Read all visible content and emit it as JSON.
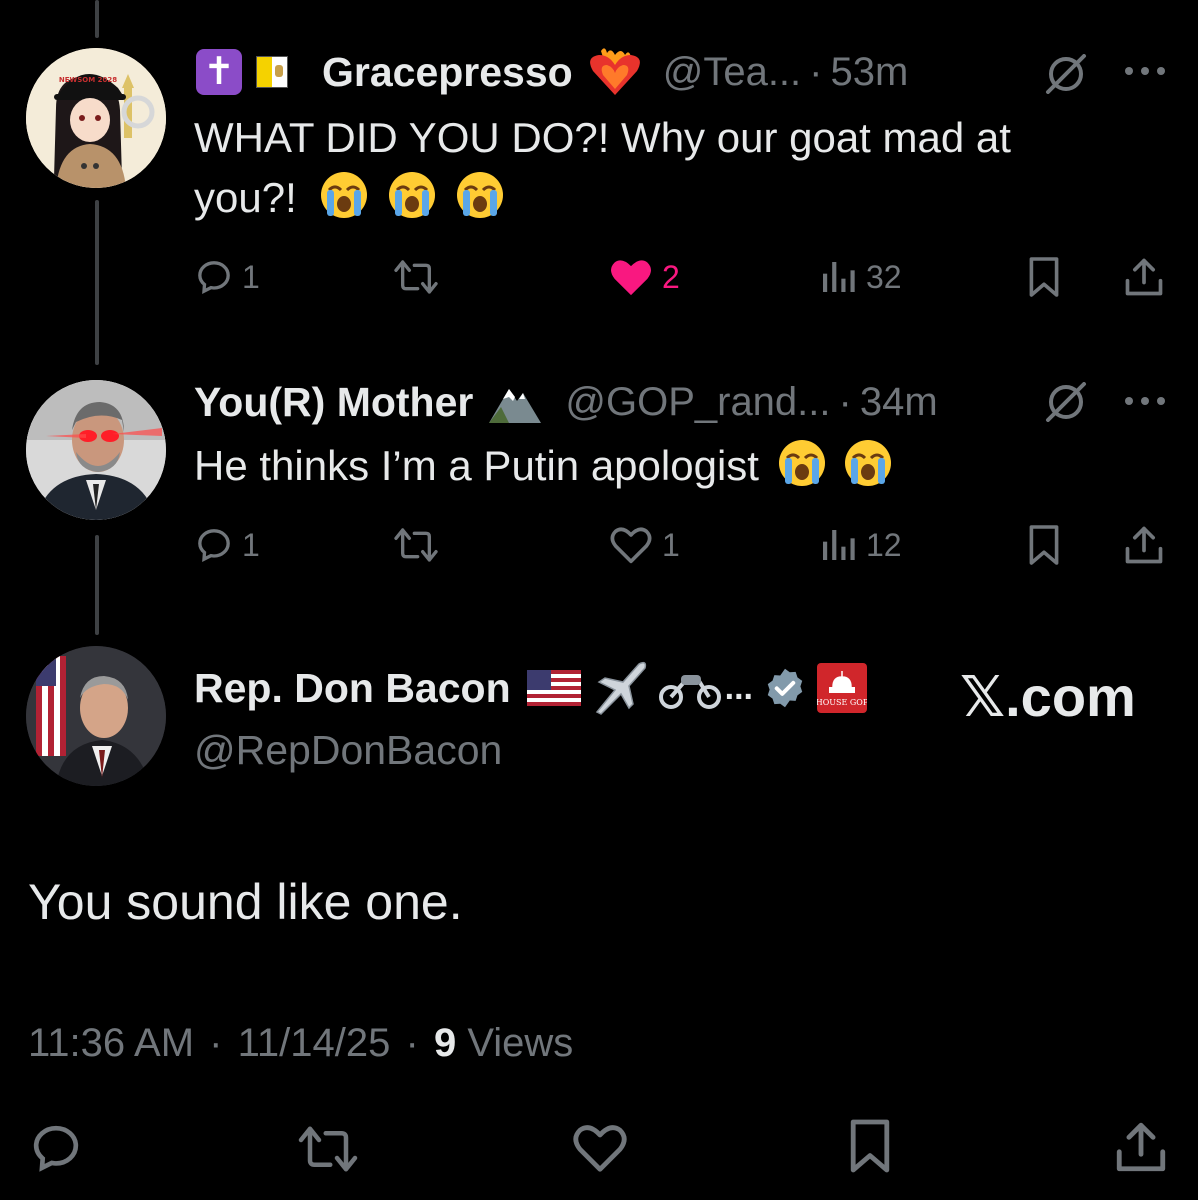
{
  "tweets": [
    {
      "badge_emojis": [
        "✝️",
        "🇻🇦"
      ],
      "name": "Gracepresso",
      "name_emoji": "❤️‍🔥",
      "handle": "@Tea...",
      "time": "53m",
      "text": "WHAT DID YOU DO?! Why our goat mad at you?!",
      "text_line1": "WHAT DID YOU DO?! Why our goat mad at",
      "text_line2": "you?!",
      "emoji_count": 3,
      "replies": "1",
      "likes": "2",
      "liked": true,
      "views": "32",
      "avatar_cap_text": "NEWSOM 2028"
    },
    {
      "name": "You(R) Mother",
      "name_emoji": "🏔️",
      "handle": "@GOP_rand...",
      "time": "34m",
      "text": "He thinks I’m a Putin apologist",
      "emoji_count": 2,
      "replies": "1",
      "likes": "1",
      "liked": false,
      "views": "12"
    }
  ],
  "main_tweet": {
    "name": "Rep. Don Bacon",
    "name_emojis": "🇺🇸 ✈️ 🏍️ ...",
    "handle": "@RepDonBacon",
    "affiliate_badge_text": "HOUSE GOP",
    "text": "You sound like one.",
    "time": "11:36 AM",
    "date": "11/14/25",
    "views_count": "9",
    "views_label": "Views"
  },
  "watermark": "𝕏.com",
  "separator": "·",
  "colors": {
    "background": "#000000",
    "text": "#e7e9ea",
    "muted": "#71767b",
    "like_pink": "#f91880",
    "verified_gray": "#829aab"
  }
}
